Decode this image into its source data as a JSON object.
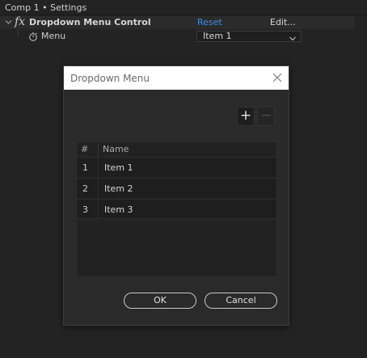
{
  "panel": {
    "title": "Comp 1 • Settings",
    "effect": {
      "fx_label": "fx",
      "name": "Dropdown Menu Control",
      "reset_label": "Reset",
      "edit_label": "Edit..."
    },
    "property": {
      "name": "Menu",
      "selected_value": "Item 1"
    }
  },
  "dialog": {
    "title": "Dropdown Menu",
    "add_label": "+",
    "remove_label": "−",
    "list": {
      "columns": {
        "num": "#",
        "name": "Name"
      },
      "rows": [
        {
          "num": "1",
          "name": "Item 1"
        },
        {
          "num": "2",
          "name": "Item 2"
        },
        {
          "num": "3",
          "name": "Item 3"
        }
      ]
    },
    "ok_label": "OK",
    "cancel_label": "Cancel"
  },
  "colors": {
    "background": "#232323",
    "link_accent": "#3d8fe6",
    "dialog_bg": "#2a2a2a",
    "titlebar_bg": "#ffffff"
  }
}
